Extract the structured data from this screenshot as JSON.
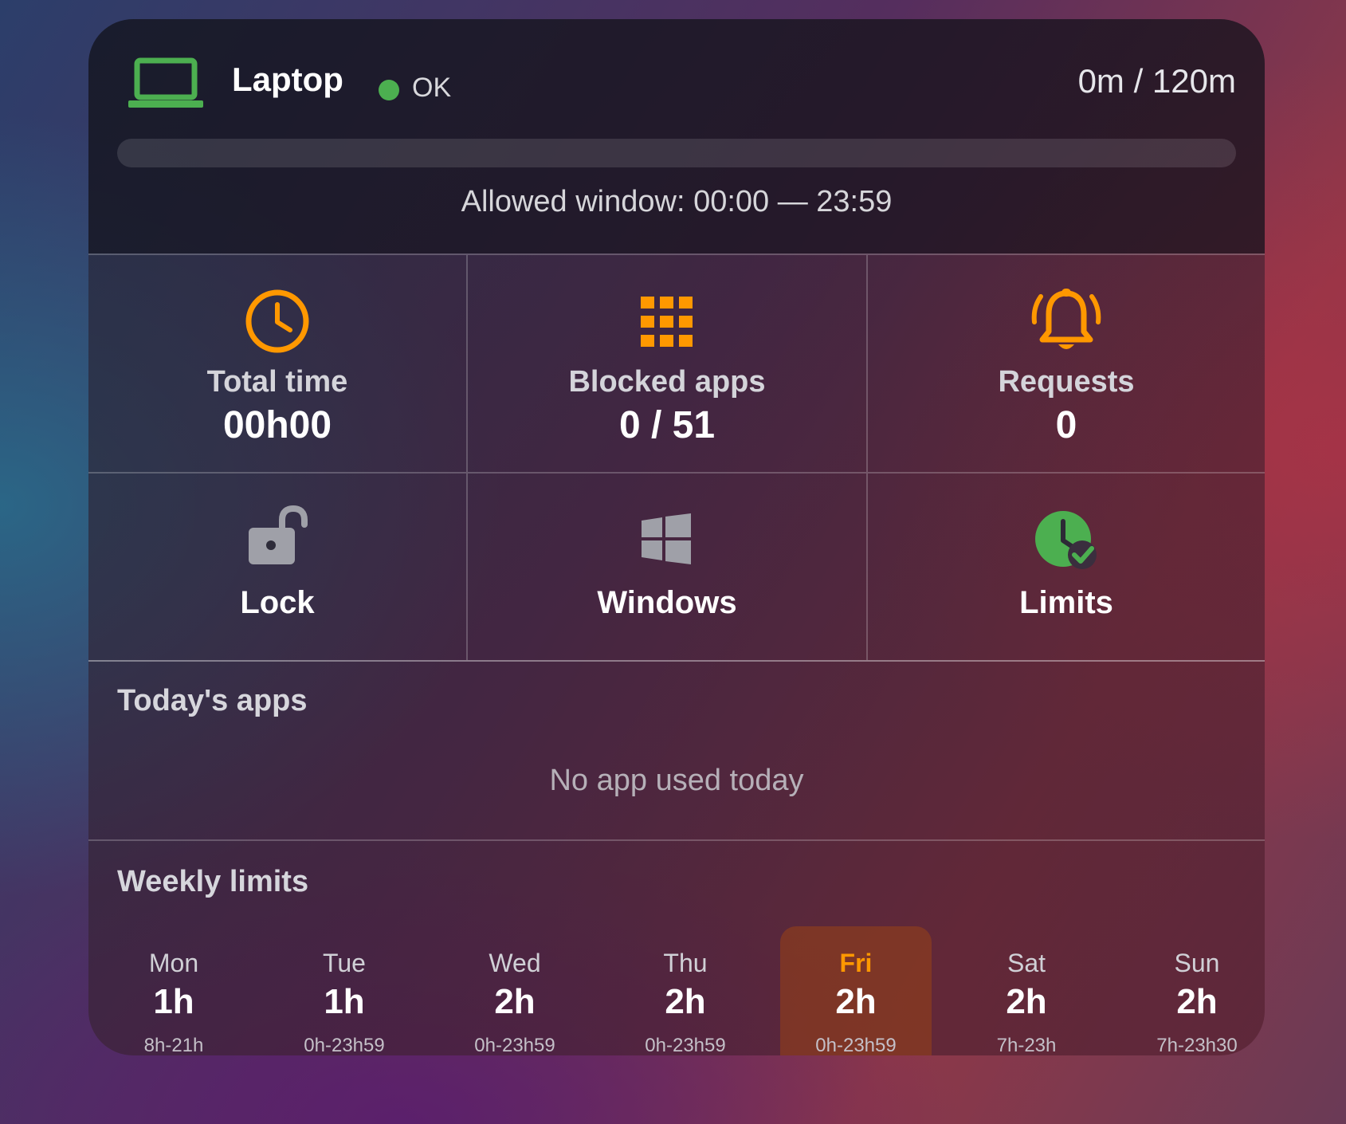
{
  "header": {
    "device_icon": "laptop-icon",
    "device_name": "Laptop",
    "status_label": "OK",
    "status_color": "#4caf50",
    "usage": "0m / 120m",
    "progress_fraction": 0,
    "allowed_window": "Allowed window: 00:00 — 23:59"
  },
  "stats": [
    {
      "icon": "clock-icon",
      "label": "Total time",
      "value": "00h00"
    },
    {
      "icon": "apps-grid-icon",
      "label": "Blocked apps",
      "value": "0 / 51"
    },
    {
      "icon": "bell-ringing-icon",
      "label": "Requests",
      "value": "0"
    }
  ],
  "actions": [
    {
      "icon": "unlocked-padlock-icon",
      "label": "Lock"
    },
    {
      "icon": "windows-logo-icon",
      "label": "Windows"
    },
    {
      "icon": "clock-check-icon",
      "label": "Limits"
    }
  ],
  "todays_apps": {
    "title": "Today's apps",
    "empty_text": "No app used today"
  },
  "weekly_limits": {
    "title": "Weekly limits",
    "today_index": 4,
    "days": [
      {
        "name": "Mon",
        "limit": "1h",
        "window": "8h-21h"
      },
      {
        "name": "Tue",
        "limit": "1h",
        "window": "0h-23h59"
      },
      {
        "name": "Wed",
        "limit": "2h",
        "window": "0h-23h59"
      },
      {
        "name": "Thu",
        "limit": "2h",
        "window": "0h-23h59"
      },
      {
        "name": "Fri",
        "limit": "2h",
        "window": "0h-23h59"
      },
      {
        "name": "Sat",
        "limit": "2h",
        "window": "7h-23h"
      },
      {
        "name": "Sun",
        "limit": "2h",
        "window": "7h-23h30"
      }
    ]
  },
  "colors": {
    "accent_orange": "#ff9800",
    "accent_green": "#4caf50",
    "icon_gray": "#9fa0a8"
  }
}
